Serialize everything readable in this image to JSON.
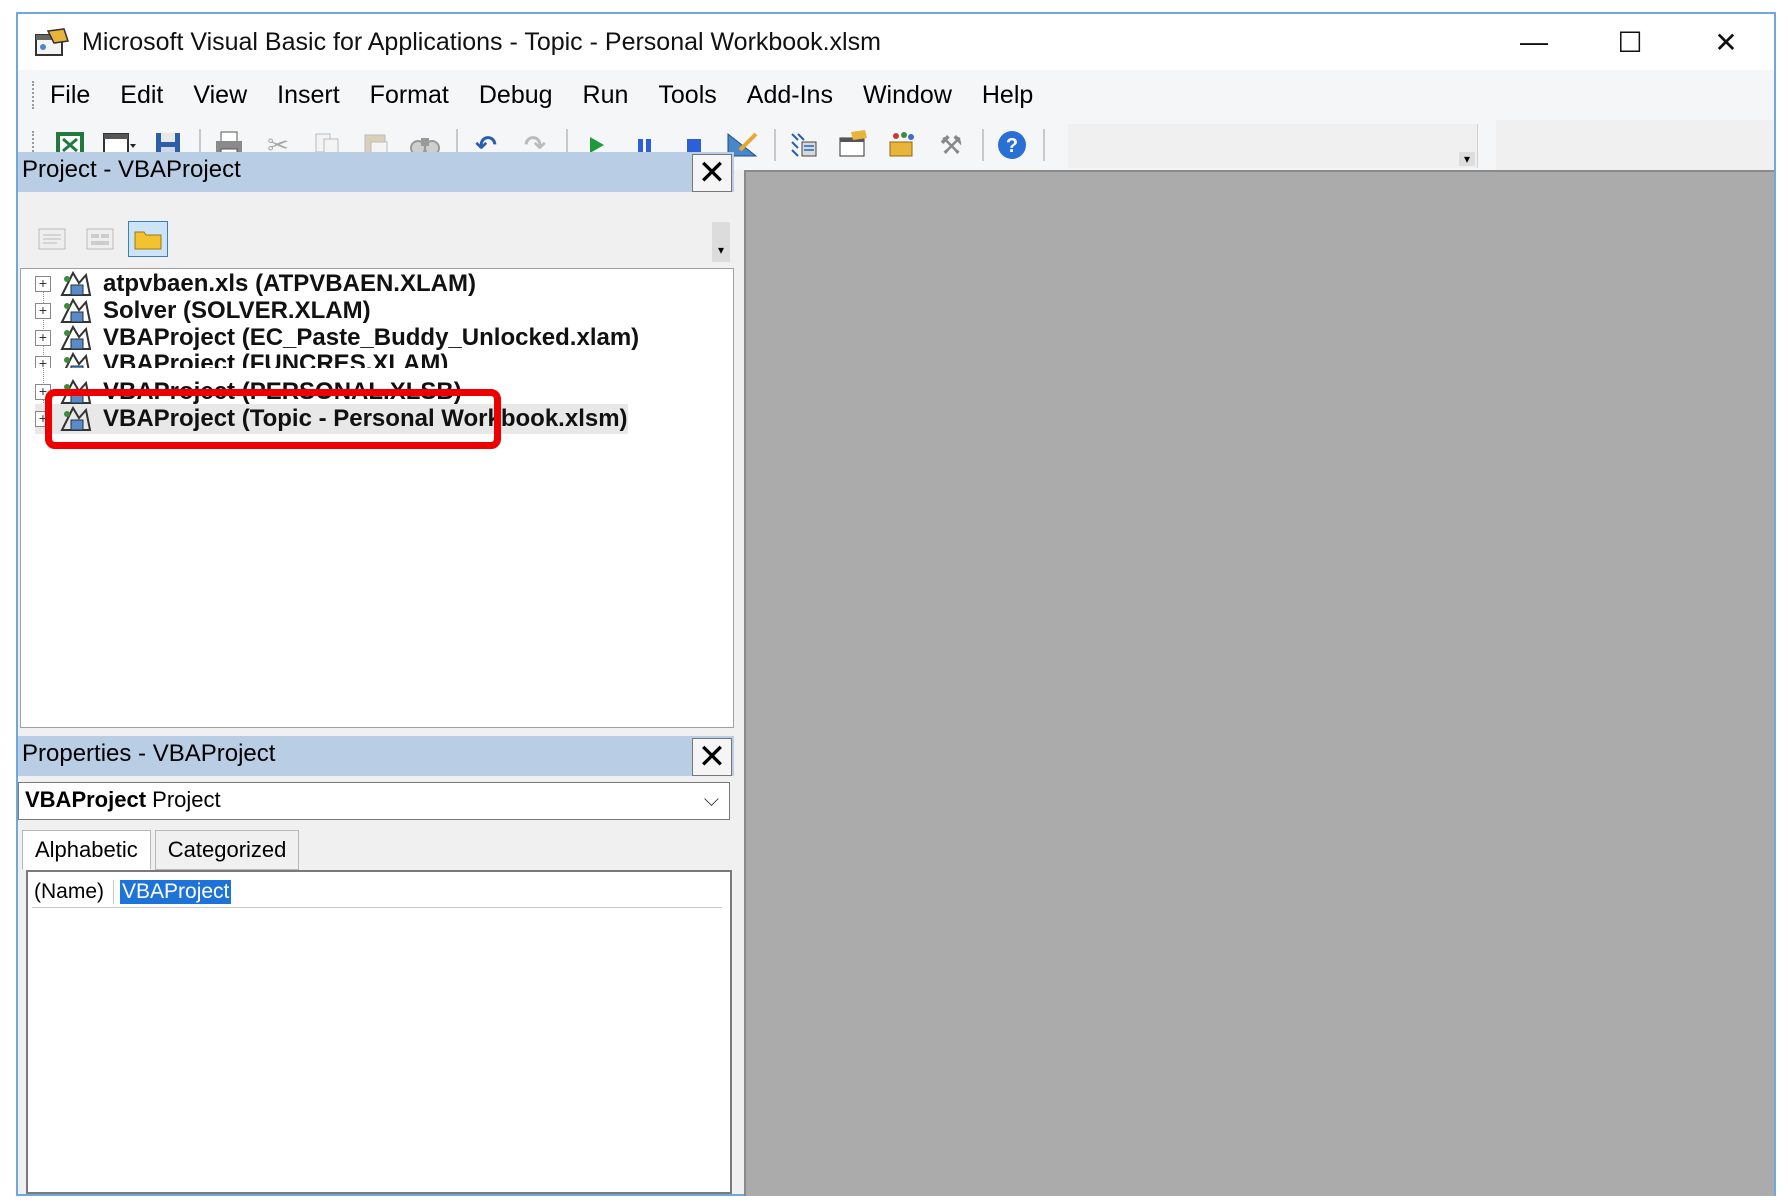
{
  "window": {
    "title": "Microsoft Visual Basic for Applications - Topic - Personal Workbook.xlsm",
    "controls": {
      "minimize": "—",
      "maximize": "☐",
      "close": "✕"
    }
  },
  "menu": [
    {
      "label": "File"
    },
    {
      "label": "Edit"
    },
    {
      "label": "View"
    },
    {
      "label": "Insert"
    },
    {
      "label": "Format"
    },
    {
      "label": "Debug"
    },
    {
      "label": "Run"
    },
    {
      "label": "Tools"
    },
    {
      "label": "Add-Ins"
    },
    {
      "label": "Window"
    },
    {
      "label": "Help"
    }
  ],
  "toolbar": {
    "icons": [
      "excel-icon",
      "insert-userform-icon",
      "save-icon",
      "print-icon",
      "cut-icon",
      "copy-icon",
      "paste-icon",
      "find-icon",
      "undo-icon",
      "redo-icon",
      "run-icon",
      "break-icon",
      "reset-icon",
      "design-mode-icon",
      "project-explorer-icon",
      "properties-window-icon",
      "object-browser-icon",
      "toolbox-icon",
      "help-icon"
    ]
  },
  "project_panel": {
    "title": "Project - VBAProject",
    "close": "✕",
    "tree": [
      {
        "label": "atpvbaen.xls (ATPVBAEN.XLAM)"
      },
      {
        "label": "Solver (SOLVER.XLAM)"
      },
      {
        "label": "VBAProject (EC_Paste_Buddy_Unlocked.xlam)"
      },
      {
        "label": "VBAProject (FUNCRES.XLAM)"
      },
      {
        "label": "VBAProject (PERSONAL.XLSB)"
      },
      {
        "label": "VBAProject (Topic - Personal Workbook.xlsm)"
      }
    ],
    "highlight_color": "#ee0000"
  },
  "properties_panel": {
    "title": "Properties - VBAProject",
    "close": "✕",
    "object_name": "VBAProject",
    "object_type": "Project",
    "tabs": [
      "Alphabetic",
      "Categorized"
    ],
    "rows": [
      {
        "name": "(Name)",
        "value": "VBAProject"
      }
    ]
  },
  "colors": {
    "panel_title_bg": "#b9cde5",
    "mdi_bg": "#ababab",
    "selection": "#1e73d8"
  }
}
